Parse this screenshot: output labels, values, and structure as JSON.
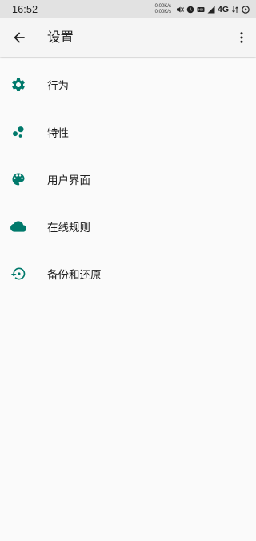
{
  "status_bar": {
    "time": "16:52",
    "net_speed_up": "0.00K/s",
    "net_speed_down": "0.00K/s",
    "network": "4G",
    "icons": [
      "mute-icon",
      "alarm-icon",
      "hd-icon",
      "signal-icon",
      "battery-icon"
    ]
  },
  "app_bar": {
    "title": "设置",
    "back_icon": "arrow-back-icon",
    "menu_icon": "more-vert-icon"
  },
  "accent_color": "#00796b",
  "items": [
    {
      "label": "行为",
      "icon": "gear-icon"
    },
    {
      "label": "特性",
      "icon": "bubbles-icon"
    },
    {
      "label": "用户界面",
      "icon": "palette-icon"
    },
    {
      "label": "在线规则",
      "icon": "cloud-icon"
    },
    {
      "label": "备份和还原",
      "icon": "restore-icon"
    }
  ]
}
